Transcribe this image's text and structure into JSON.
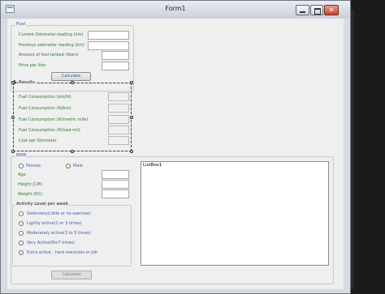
{
  "window": {
    "title": "Form1"
  },
  "fuel": {
    "caption": "Fuel",
    "fields": [
      {
        "label": "Current Odometer reading (km)"
      },
      {
        "label": "Previous odometer reading (km)"
      },
      {
        "label": "Amount of fuel tanked (liters)"
      },
      {
        "label": "Price per liter"
      }
    ],
    "calculate_label": "Calculate"
  },
  "results": {
    "caption": "Results",
    "rows": [
      {
        "label": "Fuel Consumption (km/lit)"
      },
      {
        "label": "Fuel Consumption (lit/km)"
      },
      {
        "label": "Fuel Consumption (lit/metric mile)"
      },
      {
        "label": "Fuel Consumption (lit/swe mil)"
      },
      {
        "label": "Cost per Kilometer"
      }
    ]
  },
  "bmr": {
    "caption": "BMR",
    "gender": [
      "Female",
      "Male"
    ],
    "fields": [
      {
        "label": "Age"
      },
      {
        "label": "Height (CM)"
      },
      {
        "label": "Weight (KG)"
      }
    ],
    "activity": {
      "caption": "Activity Level per week",
      "options": [
        "Sedentary(Little or no exercise)",
        "Lightly active(1 or 3 times)",
        "Moderately active(3 to 5 times)",
        "Very Active(6to7 times)",
        "Extra active , hard exercises or job"
      ]
    },
    "calculate_label": "Calculate"
  },
  "listbox": {
    "label": "ListBox1"
  }
}
